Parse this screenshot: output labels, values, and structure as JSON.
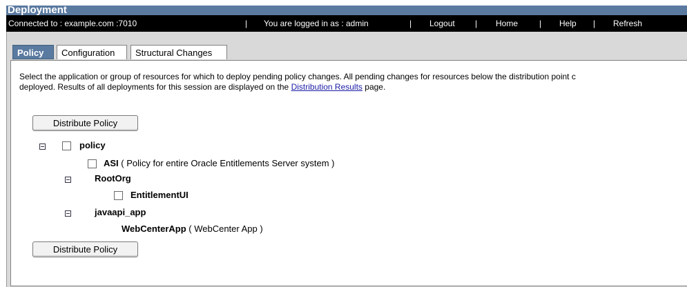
{
  "window": {
    "title": "Deployment"
  },
  "status": {
    "connected": "Connected to : example.com :7010",
    "sep": "|",
    "logged_in": "You are logged in as : admin",
    "logout": "Logout",
    "home": "Home",
    "help": "Help",
    "refresh": "Refresh"
  },
  "tabs": [
    {
      "label": "Policy",
      "active": true
    },
    {
      "label": "Configuration",
      "active": false
    },
    {
      "label": "Structural Changes",
      "active": false
    }
  ],
  "description": {
    "line1": "Select the application or group of resources for which to deploy pending policy changes. All pending changes for resources below the distribution point c",
    "line2_prefix": "deployed. Results of all deployments for this session are displayed on the ",
    "link": "Distribution Results",
    "line2_suffix": " page."
  },
  "buttons": {
    "distribute": "Distribute Policy"
  },
  "tree": {
    "policy": {
      "name": "policy"
    },
    "asi": {
      "name": "ASI",
      "desc": " ( Policy for entire Oracle Entitlements Server system )"
    },
    "rootorg": {
      "name": "RootOrg"
    },
    "entitlementui": {
      "name": "EntitlementUI"
    },
    "javaapi": {
      "name": "javaapi_app"
    },
    "webcenter": {
      "name": "WebCenterApp",
      "desc": " ( WebCenter App )"
    }
  }
}
